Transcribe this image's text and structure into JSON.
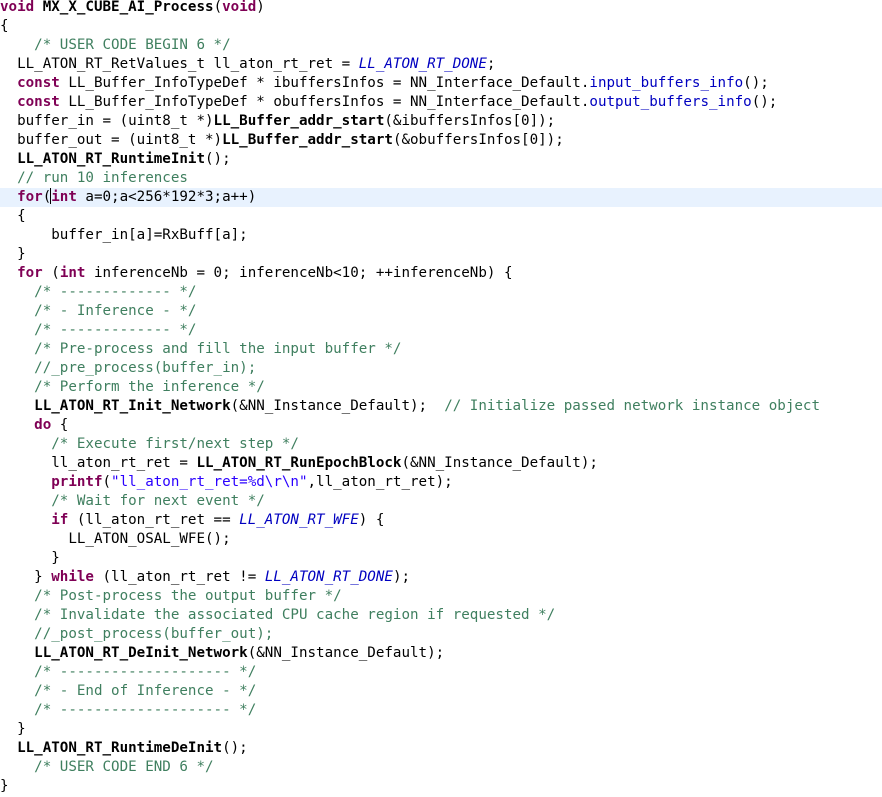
{
  "editor": {
    "lines": [
      [
        [
          "kw",
          "void "
        ],
        [
          "fn",
          "MX_X_CUBE_AI_Process"
        ],
        [
          "tx",
          "("
        ],
        [
          "kw",
          "void"
        ],
        [
          "tx",
          ")"
        ]
      ],
      [
        [
          "tx",
          "{"
        ]
      ],
      [
        [
          "tx",
          "    "
        ],
        [
          "cm",
          "/* USER CODE BEGIN 6 */"
        ]
      ],
      [
        [
          "tx",
          "  LL_ATON_RT_RetValues_t ll_aton_rt_ret = "
        ],
        [
          "en",
          "LL_ATON_RT_DONE"
        ],
        [
          "tx",
          ";"
        ]
      ],
      [
        [
          "tx",
          "  "
        ],
        [
          "kw",
          "const"
        ],
        [
          "tx",
          " LL_Buffer_InfoTypeDef * ibuffersInfos = NN_Interface_Default."
        ],
        [
          "mt",
          "input_buffers_info"
        ],
        [
          "tx",
          "();"
        ]
      ],
      [
        [
          "tx",
          "  "
        ],
        [
          "kw",
          "const"
        ],
        [
          "tx",
          " LL_Buffer_InfoTypeDef * obuffersInfos = NN_Interface_Default."
        ],
        [
          "mt",
          "output_buffers_info"
        ],
        [
          "tx",
          "();"
        ]
      ],
      [
        [
          "tx",
          "  buffer_in = (uint8_t *)"
        ],
        [
          "fn",
          "LL_Buffer_addr_start"
        ],
        [
          "tx",
          "(&ibuffersInfos[0]);"
        ]
      ],
      [
        [
          "tx",
          "  buffer_out = (uint8_t *)"
        ],
        [
          "fn",
          "LL_Buffer_addr_start"
        ],
        [
          "tx",
          "(&obuffersInfos[0]);"
        ]
      ],
      [
        [
          "tx",
          "  "
        ],
        [
          "fn",
          "LL_ATON_RT_RuntimeInit"
        ],
        [
          "tx",
          "();"
        ]
      ],
      [
        [
          "tx",
          "  "
        ],
        [
          "cm",
          "// run 10 inferences"
        ]
      ],
      [
        [
          "tx",
          "  "
        ],
        [
          "kw",
          "for"
        ],
        [
          "tx",
          "("
        ],
        [
          "caret",
          ""
        ],
        [
          "kw",
          "int"
        ],
        [
          "tx",
          " a=0;a<256*192*3;a++)"
        ]
      ],
      [
        [
          "tx",
          "  {"
        ]
      ],
      [
        [
          "tx",
          "      buffer_in[a]=RxBuff[a];"
        ]
      ],
      [
        [
          "tx",
          "  }"
        ]
      ],
      [
        [
          "tx",
          "  "
        ],
        [
          "kw",
          "for"
        ],
        [
          "tx",
          " ("
        ],
        [
          "kw",
          "int"
        ],
        [
          "tx",
          " inferenceNb = 0; inferenceNb<10; ++inferenceNb) {"
        ]
      ],
      [
        [
          "tx",
          "    "
        ],
        [
          "cm",
          "/* ------------- */"
        ]
      ],
      [
        [
          "tx",
          "    "
        ],
        [
          "cm",
          "/* - Inference - */"
        ]
      ],
      [
        [
          "tx",
          "    "
        ],
        [
          "cm",
          "/* ------------- */"
        ]
      ],
      [
        [
          "tx",
          "    "
        ],
        [
          "cm",
          "/* Pre-process and fill the input buffer */"
        ]
      ],
      [
        [
          "tx",
          "    "
        ],
        [
          "cm",
          "//_pre_process(buffer_in);"
        ]
      ],
      [
        [
          "tx",
          "    "
        ],
        [
          "cm",
          "/* Perform the inference */"
        ]
      ],
      [
        [
          "tx",
          "    "
        ],
        [
          "fn",
          "LL_ATON_RT_Init_Network"
        ],
        [
          "tx",
          "(&NN_Instance_Default);  "
        ],
        [
          "cm",
          "// Initialize passed network instance object"
        ]
      ],
      [
        [
          "tx",
          "    "
        ],
        [
          "kw",
          "do"
        ],
        [
          "tx",
          " {"
        ]
      ],
      [
        [
          "tx",
          "      "
        ],
        [
          "cm",
          "/* Execute first/next step */"
        ]
      ],
      [
        [
          "tx",
          "      ll_aton_rt_ret = "
        ],
        [
          "fn",
          "LL_ATON_RT_RunEpochBlock"
        ],
        [
          "tx",
          "(&NN_Instance_Default);"
        ]
      ],
      [
        [
          "tx",
          "      "
        ],
        [
          "kw",
          "printf"
        ],
        [
          "tx",
          "("
        ],
        [
          "str",
          "\"ll_aton_rt_ret=%d\\r\\n\""
        ],
        [
          "tx",
          ",ll_aton_rt_ret);"
        ]
      ],
      [
        [
          "tx",
          "      "
        ],
        [
          "cm",
          "/* Wait for next event */"
        ]
      ],
      [
        [
          "tx",
          "      "
        ],
        [
          "kw",
          "if"
        ],
        [
          "tx",
          " (ll_aton_rt_ret == "
        ],
        [
          "en",
          "LL_ATON_RT_WFE"
        ],
        [
          "tx",
          ") {"
        ]
      ],
      [
        [
          "tx",
          "        LL_ATON_OSAL_WFE();"
        ]
      ],
      [
        [
          "tx",
          "      }"
        ]
      ],
      [
        [
          "tx",
          "    } "
        ],
        [
          "kw",
          "while"
        ],
        [
          "tx",
          " (ll_aton_rt_ret != "
        ],
        [
          "en",
          "LL_ATON_RT_DONE"
        ],
        [
          "tx",
          ");"
        ]
      ],
      [
        [
          "tx",
          "    "
        ],
        [
          "cm",
          "/* Post-process the output buffer */"
        ]
      ],
      [
        [
          "tx",
          "    "
        ],
        [
          "cm",
          "/* Invalidate the associated CPU cache region if requested */"
        ]
      ],
      [
        [
          "tx",
          "    "
        ],
        [
          "cm",
          "//_post_process(buffer_out);"
        ]
      ],
      [
        [
          "tx",
          "    "
        ],
        [
          "fn",
          "LL_ATON_RT_DeInit_Network"
        ],
        [
          "tx",
          "(&NN_Instance_Default);"
        ]
      ],
      [
        [
          "tx",
          "    "
        ],
        [
          "cm",
          "/* -------------------- */"
        ]
      ],
      [
        [
          "tx",
          "    "
        ],
        [
          "cm",
          "/* - End of Inference - */"
        ]
      ],
      [
        [
          "tx",
          "    "
        ],
        [
          "cm",
          "/* -------------------- */"
        ]
      ],
      [
        [
          "tx",
          "  }"
        ]
      ],
      [
        [
          "tx",
          "  "
        ],
        [
          "fn",
          "LL_ATON_RT_RuntimeDeInit"
        ],
        [
          "tx",
          "();"
        ]
      ],
      [
        [
          "tx",
          "    "
        ],
        [
          "cm",
          "/* USER CODE END 6 */"
        ]
      ],
      [
        [
          "tx",
          "}"
        ]
      ]
    ],
    "current_line": 10,
    "colors": {
      "keyword": "#7f0055",
      "comment": "#3f7f5f",
      "enum_constant": "#0000c0",
      "string": "#2a00ff",
      "current_line_highlight": "#e8f2fe"
    }
  }
}
